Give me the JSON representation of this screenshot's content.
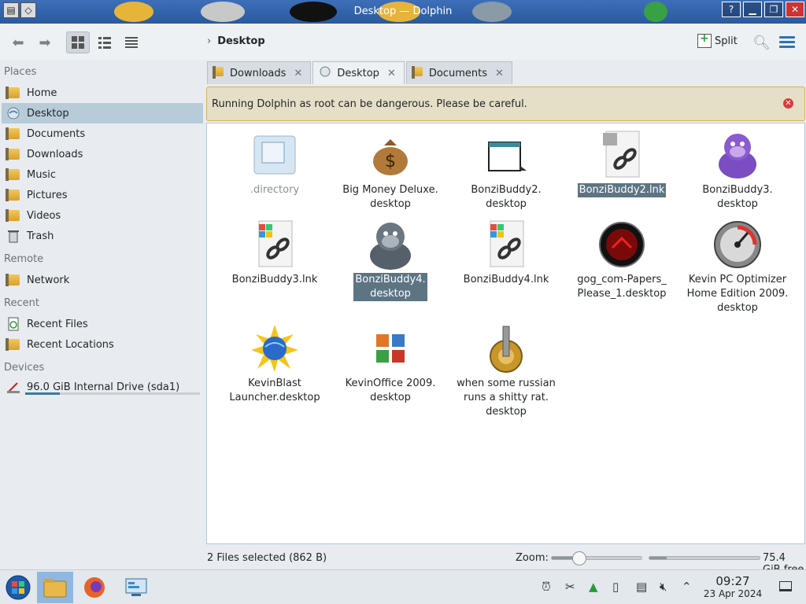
{
  "window": {
    "title": "Desktop — Dolphin"
  },
  "toolbar": {
    "breadcrumb": "Desktop",
    "split_label": "Split"
  },
  "sidebar": {
    "places_title": "Places",
    "places": [
      {
        "label": "Home"
      },
      {
        "label": "Desktop"
      },
      {
        "label": "Documents"
      },
      {
        "label": "Downloads"
      },
      {
        "label": "Music"
      },
      {
        "label": "Pictures"
      },
      {
        "label": "Videos"
      },
      {
        "label": "Trash"
      }
    ],
    "remote_title": "Remote",
    "remote": [
      {
        "label": "Network"
      }
    ],
    "recent_title": "Recent",
    "recent": [
      {
        "label": "Recent Files"
      },
      {
        "label": "Recent Locations"
      }
    ],
    "devices_title": "Devices",
    "devices": [
      {
        "label": "96.0 GiB Internal Drive (sda1)",
        "used_fraction": 0.2
      }
    ]
  },
  "tabs": [
    {
      "label": "Downloads",
      "close": "✕"
    },
    {
      "label": "Desktop",
      "close": "✕"
    },
    {
      "label": "Documents",
      "close": "✕"
    }
  ],
  "warning": {
    "text": "Running Dolphin as root can be dangerous. Please be careful.",
    "close": "✕"
  },
  "files": [
    {
      "label": ".directory"
    },
    {
      "label": "Big Money Deluxe.\ndesktop"
    },
    {
      "label": "BonziBuddy2.\ndesktop"
    },
    {
      "label": "BonziBuddy2.lnk"
    },
    {
      "label": "BonziBuddy3.\ndesktop"
    },
    {
      "label": "BonziBuddy3.lnk"
    },
    {
      "label": "BonziBuddy4.\ndesktop"
    },
    {
      "label": "BonziBuddy4.lnk"
    },
    {
      "label": "gog_com-Papers_\nPlease_1.desktop"
    },
    {
      "label": "Kevin PC Optimizer\nHome Edition 2009.\ndesktop"
    },
    {
      "label": "KevinBlast\nLauncher.desktop"
    },
    {
      "label": "KevinOffice 2009.\ndesktop"
    },
    {
      "label": "when some russian\nruns a shitty rat.\ndesktop"
    }
  ],
  "status": {
    "selection": "2 Files selected (862 B)",
    "zoom_label": "Zoom:",
    "free_space": "75.4 GiB free",
    "zoom_level": 0.3,
    "used_fraction": 0.16
  },
  "taskbar": {
    "time": "09:27",
    "date": "23 Apr 2024"
  },
  "colors": {
    "selection": "#b7cbd9",
    "file_selection": "#5d7483",
    "warning_border": "#d7b350",
    "accent": "#2f72b8"
  }
}
